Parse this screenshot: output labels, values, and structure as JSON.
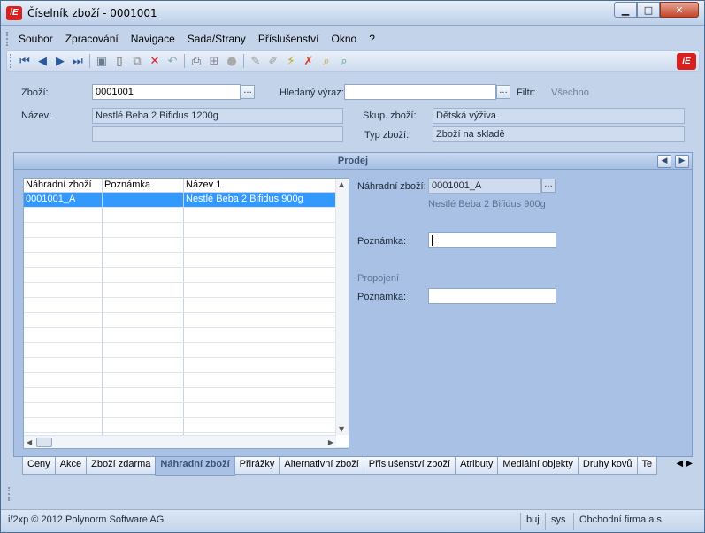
{
  "window": {
    "title": "Číselník zboží - 0001001",
    "logo": "iE"
  },
  "menu": [
    "Soubor",
    "Zpracování",
    "Navigace",
    "Sada/Strany",
    "Příslušenství",
    "Okno",
    "?"
  ],
  "toolbar": {
    "icons": [
      "first-record-icon",
      "prev-record-icon",
      "next-record-icon",
      "last-record-icon",
      "save-icon",
      "new-icon",
      "copy-icon",
      "delete-icon",
      "undo-icon",
      "print-icon",
      "tree-icon",
      "circle-icon",
      "edit-icon",
      "edit-alt-icon",
      "filter-icon",
      "filter-clear-icon",
      "search-icon",
      "search-advanced-icon"
    ],
    "logo": "iE"
  },
  "form": {
    "zbozi_label": "Zboží:",
    "zbozi_value": "0001001",
    "hledany_label": "Hledaný výraz:",
    "hledany_value": "",
    "filtr_label": "Filtr:",
    "filtr_value": "Všechno",
    "nazev_label": "Název:",
    "nazev_value": "Nestlé Beba 2 Bifidus 1200g",
    "nazev2_value": "",
    "skup_label": "Skup. zboží:",
    "skup_value": "Dětská výživa",
    "typ_label": "Typ zboží:",
    "typ_value": "Zboží na skladě",
    "dots": "..."
  },
  "panel": {
    "title": "Prodej",
    "grid": {
      "headers": [
        "Náhradní zboží",
        "Poznámka",
        "Název 1"
      ],
      "rows": [
        [
          "0001001_A",
          "",
          "Nestlé Beba 2 Bifidus 900g"
        ]
      ],
      "empty_rows": 16
    },
    "detail": {
      "nahradni_label": "Náhradní zboží:",
      "nahradni_value": "0001001_A",
      "nahradni_name": "Nestlé Beba 2 Bifidus 900g",
      "poznamka_label": "Poznámka:",
      "poznamka_value": "",
      "propojeni_label": "Propojení",
      "poznamka2_label": "Poznámka:",
      "poznamka2_value": ""
    }
  },
  "tabs": [
    "Ceny",
    "Akce",
    "Zboží zdarma",
    "Náhradní zboží",
    "Přirážky",
    "Alternativní zboží",
    "Příslušenství zboží",
    "Atributy",
    "Mediální objekty",
    "Druhy kovů",
    "Te"
  ],
  "active_tab": "Náhradní zboží",
  "status": {
    "copyright": "i/2xp © 2012 Polynorm Software AG",
    "user": "buj",
    "system": "sys",
    "company": "Obchodní firma a.s."
  },
  "colors": {
    "selection": "#3399ff",
    "panel": "#a9c1e4",
    "close": "#c4452c",
    "logo": "#d8211f"
  }
}
